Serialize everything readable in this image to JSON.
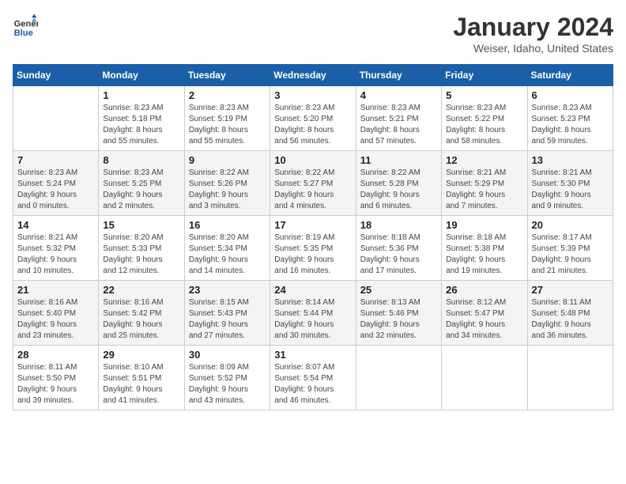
{
  "header": {
    "logo_line1": "General",
    "logo_line2": "Blue",
    "title": "January 2024",
    "subtitle": "Weiser, Idaho, United States"
  },
  "days_of_week": [
    "Sunday",
    "Monday",
    "Tuesday",
    "Wednesday",
    "Thursday",
    "Friday",
    "Saturday"
  ],
  "weeks": [
    [
      {
        "day": "",
        "info": ""
      },
      {
        "day": "1",
        "info": "Sunrise: 8:23 AM\nSunset: 5:18 PM\nDaylight: 8 hours\nand 55 minutes."
      },
      {
        "day": "2",
        "info": "Sunrise: 8:23 AM\nSunset: 5:19 PM\nDaylight: 8 hours\nand 55 minutes."
      },
      {
        "day": "3",
        "info": "Sunrise: 8:23 AM\nSunset: 5:20 PM\nDaylight: 8 hours\nand 56 minutes."
      },
      {
        "day": "4",
        "info": "Sunrise: 8:23 AM\nSunset: 5:21 PM\nDaylight: 8 hours\nand 57 minutes."
      },
      {
        "day": "5",
        "info": "Sunrise: 8:23 AM\nSunset: 5:22 PM\nDaylight: 8 hours\nand 58 minutes."
      },
      {
        "day": "6",
        "info": "Sunrise: 8:23 AM\nSunset: 5:23 PM\nDaylight: 8 hours\nand 59 minutes."
      }
    ],
    [
      {
        "day": "7",
        "info": "Sunrise: 8:23 AM\nSunset: 5:24 PM\nDaylight: 9 hours\nand 0 minutes."
      },
      {
        "day": "8",
        "info": "Sunrise: 8:23 AM\nSunset: 5:25 PM\nDaylight: 9 hours\nand 2 minutes."
      },
      {
        "day": "9",
        "info": "Sunrise: 8:22 AM\nSunset: 5:26 PM\nDaylight: 9 hours\nand 3 minutes."
      },
      {
        "day": "10",
        "info": "Sunrise: 8:22 AM\nSunset: 5:27 PM\nDaylight: 9 hours\nand 4 minutes."
      },
      {
        "day": "11",
        "info": "Sunrise: 8:22 AM\nSunset: 5:28 PM\nDaylight: 9 hours\nand 6 minutes."
      },
      {
        "day": "12",
        "info": "Sunrise: 8:21 AM\nSunset: 5:29 PM\nDaylight: 9 hours\nand 7 minutes."
      },
      {
        "day": "13",
        "info": "Sunrise: 8:21 AM\nSunset: 5:30 PM\nDaylight: 9 hours\nand 9 minutes."
      }
    ],
    [
      {
        "day": "14",
        "info": "Sunrise: 8:21 AM\nSunset: 5:32 PM\nDaylight: 9 hours\nand 10 minutes."
      },
      {
        "day": "15",
        "info": "Sunrise: 8:20 AM\nSunset: 5:33 PM\nDaylight: 9 hours\nand 12 minutes."
      },
      {
        "day": "16",
        "info": "Sunrise: 8:20 AM\nSunset: 5:34 PM\nDaylight: 9 hours\nand 14 minutes."
      },
      {
        "day": "17",
        "info": "Sunrise: 8:19 AM\nSunset: 5:35 PM\nDaylight: 9 hours\nand 16 minutes."
      },
      {
        "day": "18",
        "info": "Sunrise: 8:18 AM\nSunset: 5:36 PM\nDaylight: 9 hours\nand 17 minutes."
      },
      {
        "day": "19",
        "info": "Sunrise: 8:18 AM\nSunset: 5:38 PM\nDaylight: 9 hours\nand 19 minutes."
      },
      {
        "day": "20",
        "info": "Sunrise: 8:17 AM\nSunset: 5:39 PM\nDaylight: 9 hours\nand 21 minutes."
      }
    ],
    [
      {
        "day": "21",
        "info": "Sunrise: 8:16 AM\nSunset: 5:40 PM\nDaylight: 9 hours\nand 23 minutes."
      },
      {
        "day": "22",
        "info": "Sunrise: 8:16 AM\nSunset: 5:42 PM\nDaylight: 9 hours\nand 25 minutes."
      },
      {
        "day": "23",
        "info": "Sunrise: 8:15 AM\nSunset: 5:43 PM\nDaylight: 9 hours\nand 27 minutes."
      },
      {
        "day": "24",
        "info": "Sunrise: 8:14 AM\nSunset: 5:44 PM\nDaylight: 9 hours\nand 30 minutes."
      },
      {
        "day": "25",
        "info": "Sunrise: 8:13 AM\nSunset: 5:46 PM\nDaylight: 9 hours\nand 32 minutes."
      },
      {
        "day": "26",
        "info": "Sunrise: 8:12 AM\nSunset: 5:47 PM\nDaylight: 9 hours\nand 34 minutes."
      },
      {
        "day": "27",
        "info": "Sunrise: 8:11 AM\nSunset: 5:48 PM\nDaylight: 9 hours\nand 36 minutes."
      }
    ],
    [
      {
        "day": "28",
        "info": "Sunrise: 8:11 AM\nSunset: 5:50 PM\nDaylight: 9 hours\nand 39 minutes."
      },
      {
        "day": "29",
        "info": "Sunrise: 8:10 AM\nSunset: 5:51 PM\nDaylight: 9 hours\nand 41 minutes."
      },
      {
        "day": "30",
        "info": "Sunrise: 8:09 AM\nSunset: 5:52 PM\nDaylight: 9 hours\nand 43 minutes."
      },
      {
        "day": "31",
        "info": "Sunrise: 8:07 AM\nSunset: 5:54 PM\nDaylight: 9 hours\nand 46 minutes."
      },
      {
        "day": "",
        "info": ""
      },
      {
        "day": "",
        "info": ""
      },
      {
        "day": "",
        "info": ""
      }
    ]
  ]
}
